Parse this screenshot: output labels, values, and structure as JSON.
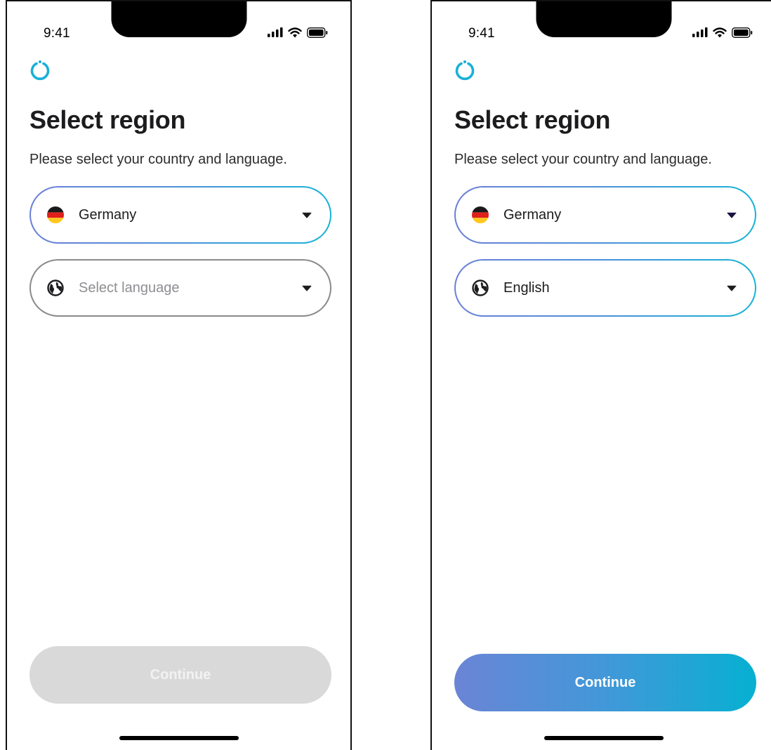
{
  "status_bar": {
    "time": "9:41",
    "signal_icon": "cellular-signal-icon",
    "wifi_icon": "wifi-icon",
    "battery_icon": "battery-icon"
  },
  "brand": {
    "logo_icon": "power-ring-logo-icon",
    "accent": "#1ab0d8",
    "gradient_start": "#6b7fd7",
    "gradient_end": "#06b0d1"
  },
  "screens": [
    {
      "title": "Select region",
      "subtitle": "Please select your country and language.",
      "country": {
        "value": "Germany",
        "icon": "germany-flag-icon",
        "active": true
      },
      "language": {
        "value": "",
        "placeholder": "Select language",
        "icon": "globe-icon",
        "active": false
      },
      "continue": {
        "label": "Continue",
        "enabled": false
      }
    },
    {
      "title": "Select region",
      "subtitle": "Please select your country and language.",
      "country": {
        "value": "Germany",
        "icon": "germany-flag-icon",
        "active": true
      },
      "language": {
        "value": "English",
        "placeholder": "Select language",
        "icon": "globe-icon",
        "active": true
      },
      "continue": {
        "label": "Continue",
        "enabled": true
      }
    }
  ]
}
